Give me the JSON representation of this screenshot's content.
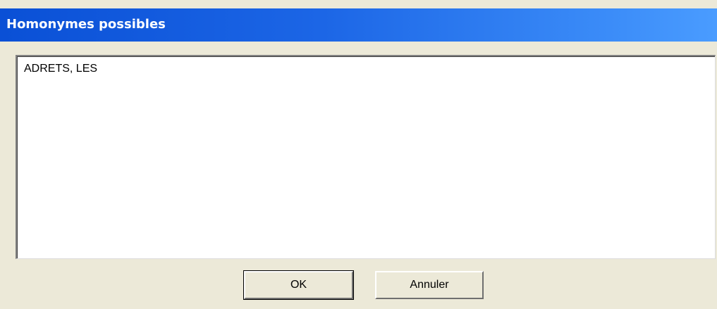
{
  "window": {
    "title": "Homonymes possibles"
  },
  "list": {
    "items": [
      "ADRETS, LES"
    ]
  },
  "buttons": {
    "ok_label": "OK",
    "cancel_label": "Annuler"
  },
  "colors": {
    "title_bar_start": "#0a50d6",
    "title_bar_end": "#4a9cff",
    "dialog_face": "#ece9d8",
    "list_background": "#ffffff"
  }
}
